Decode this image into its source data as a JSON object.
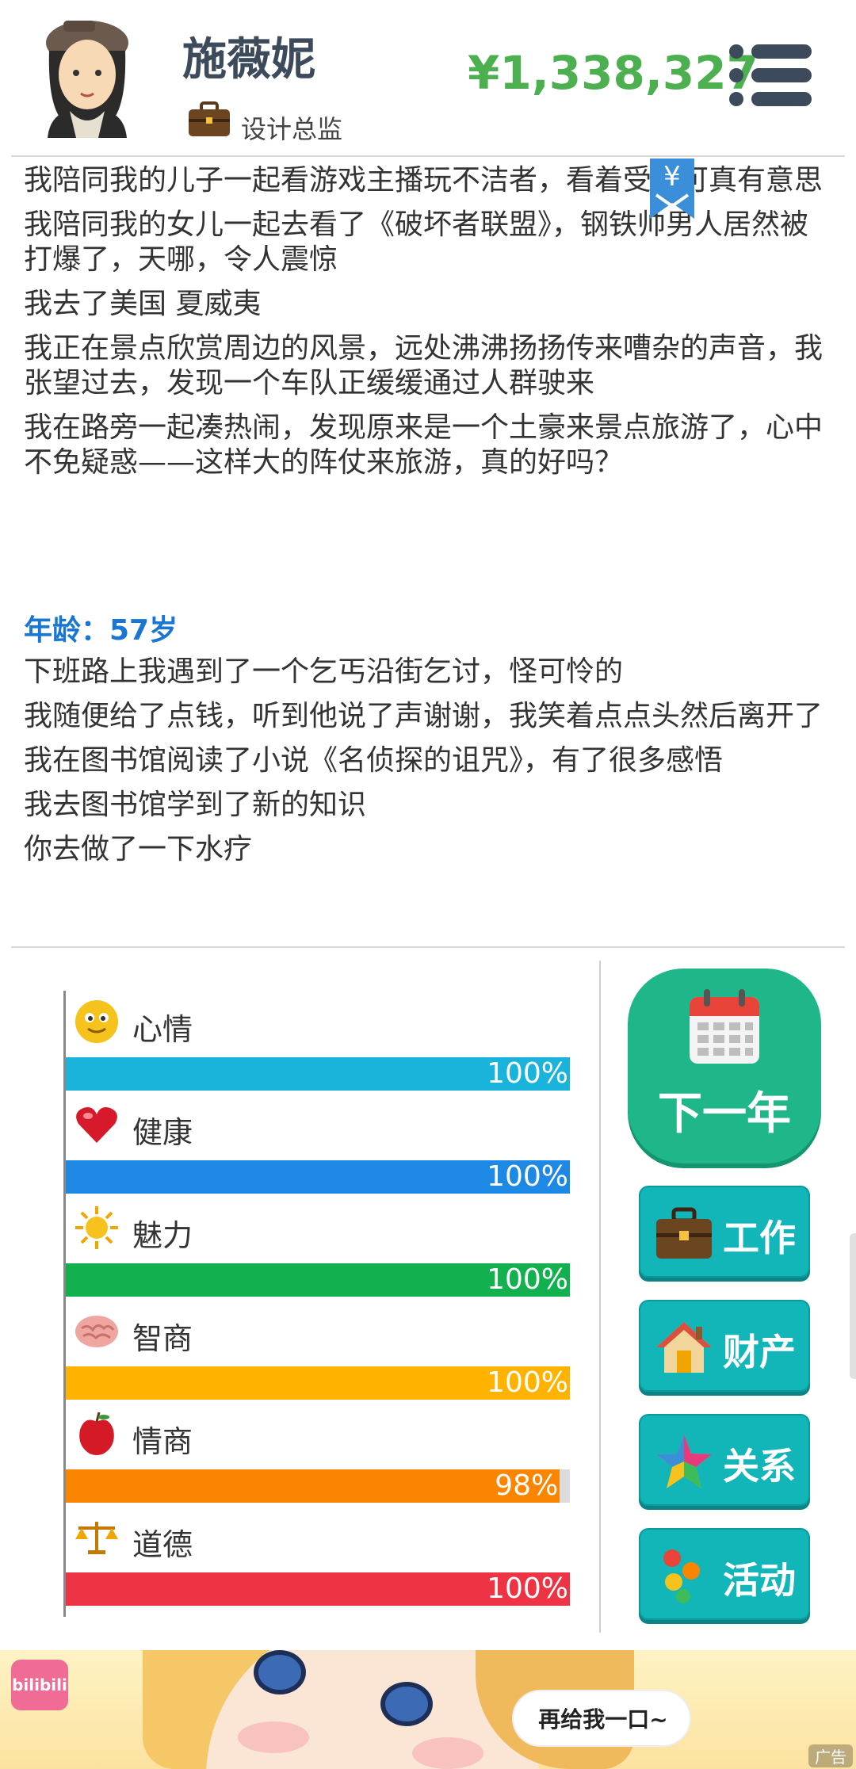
{
  "header": {
    "name": "施薇妮",
    "job": "设计总监",
    "money": "¥1,338,327"
  },
  "bookmark": {
    "symbol": "¥"
  },
  "log_entries": [
    "我陪同我的儿子一起看游戏主播玩不洁者，看着受苦可真有意思",
    "我陪同我的女儿一起去看了《破坏者联盟》，钢铁帅男人居然被打爆了，天哪，令人震惊",
    "我去了美国 夏威夷",
    "我正在景点欣赏周边的风景，远处沸沸扬扬传来嘈杂的声音，我张望过去，发现一个车队正缓缓通过人群驶来",
    "我在路旁一起凑热闹，发现原来是一个土豪来景点旅游了，心中不免疑惑——这样大的阵仗来旅游，真的好吗？"
  ],
  "age_label": "年龄：57岁",
  "log_entries_2": [
    "下班路上我遇到了一个乞丐沿街乞讨，怪可怜的",
    "我随便给了点钱，听到他说了声谢谢，我笑着点点头然后离开了",
    "我在图书馆阅读了小说《名侦探的诅咒》，有了很多感悟",
    "我去图书馆学到了新的知识",
    "你去做了一下水疗"
  ],
  "stats": [
    {
      "label": "心情",
      "value": 100,
      "display": "100%",
      "color": "#1ab3dc",
      "icon": "smiley-icon"
    },
    {
      "label": "健康",
      "value": 100,
      "display": "100%",
      "color": "#1e88e5",
      "icon": "heart-icon"
    },
    {
      "label": "魅力",
      "value": 100,
      "display": "100%",
      "color": "#12b04f",
      "icon": "sun-icon"
    },
    {
      "label": "智商",
      "value": 100,
      "display": "100%",
      "color": "#ffb300",
      "icon": "brain-icon"
    },
    {
      "label": "情商",
      "value": 98,
      "display": "98%",
      "color": "#fb8500",
      "icon": "apple-icon"
    },
    {
      "label": "道德",
      "value": 100,
      "display": "100%",
      "color": "#ee3344",
      "icon": "scales-icon"
    }
  ],
  "actions": {
    "next_year": "下一年",
    "work": "工作",
    "assets": "财产",
    "relations": "关系",
    "activities": "活动"
  },
  "ad": {
    "brand": "bilibili",
    "bubble": "再给我一口~",
    "tag": "广告"
  }
}
